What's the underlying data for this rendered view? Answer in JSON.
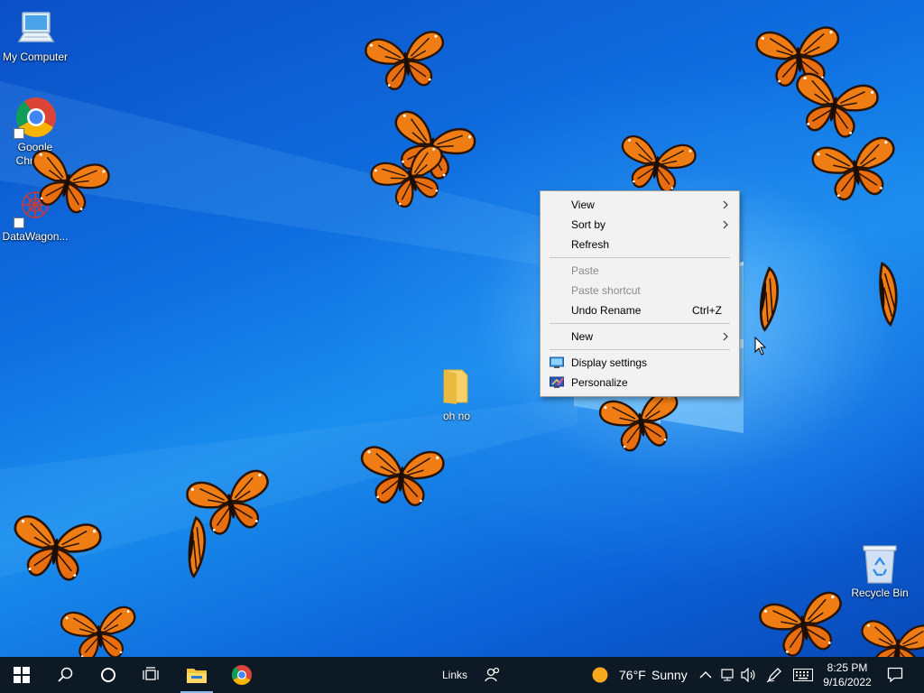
{
  "desktop": {
    "icons": [
      {
        "label": "My Computer",
        "icon": "computer-icon"
      },
      {
        "label": "Google Chrome",
        "icon": "chrome-icon"
      },
      {
        "label": "DataWagon...",
        "icon": "datawagon-icon"
      },
      {
        "label": "oh no",
        "icon": "folder-icon"
      },
      {
        "label": "Recycle Bin",
        "icon": "recycle-bin-icon"
      }
    ]
  },
  "context_menu": {
    "items": [
      {
        "label": "View",
        "submenu": true
      },
      {
        "label": "Sort by",
        "submenu": true
      },
      {
        "label": "Refresh"
      },
      {
        "label": "Paste",
        "disabled": true
      },
      {
        "label": "Paste shortcut",
        "disabled": true
      },
      {
        "label": "Undo Rename",
        "shortcut": "Ctrl+Z"
      },
      {
        "label": "New",
        "submenu": true
      },
      {
        "label": "Display settings",
        "icon": "display-settings-icon"
      },
      {
        "label": "Personalize",
        "icon": "personalize-icon"
      }
    ]
  },
  "taskbar": {
    "links_label": "Links",
    "weather_temp": "76°F",
    "weather_cond": "Sunny",
    "time": "8:25 PM",
    "date": "9/16/2022"
  },
  "colors": {
    "taskbar_bg": "#0d1a26",
    "menu_bg": "#f2f2f2",
    "wallpaper_blue": "#0f6fe0"
  }
}
